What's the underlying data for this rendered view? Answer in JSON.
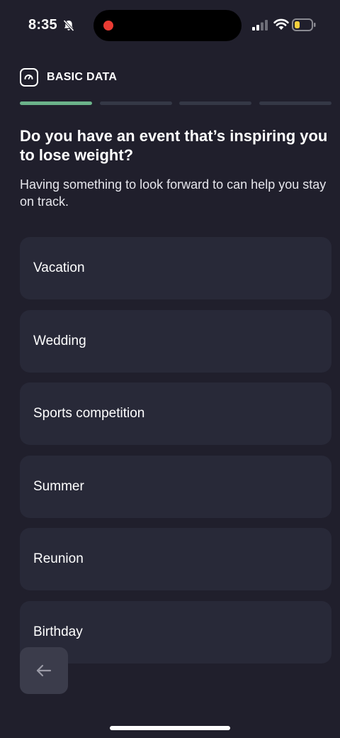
{
  "status_bar": {
    "time": "8:35",
    "icons": [
      "bell-slash-icon",
      "signal-icon",
      "wifi-icon",
      "battery-low-icon"
    ],
    "recording_color": "#ea3b33"
  },
  "header": {
    "icon": "gauge-icon",
    "title": "BASIC DATA"
  },
  "progress": {
    "total_steps": 4,
    "current_step": 1,
    "active_color": "#6bb28a",
    "inactive_color": "#343846"
  },
  "question": {
    "title": "Do you have an event that’s inspiring you to lose weight?",
    "subtitle": "Having something to look forward to can help you stay on track."
  },
  "options": [
    {
      "label": "Vacation"
    },
    {
      "label": "Wedding"
    },
    {
      "label": "Sports competition"
    },
    {
      "label": "Summer"
    },
    {
      "label": "Reunion"
    },
    {
      "label": "Birthday"
    }
  ],
  "navigation": {
    "back_icon": "arrow-left-icon"
  },
  "colors": {
    "background": "#201f2c",
    "card": "#282938",
    "back_button": "#3b3c4b"
  }
}
